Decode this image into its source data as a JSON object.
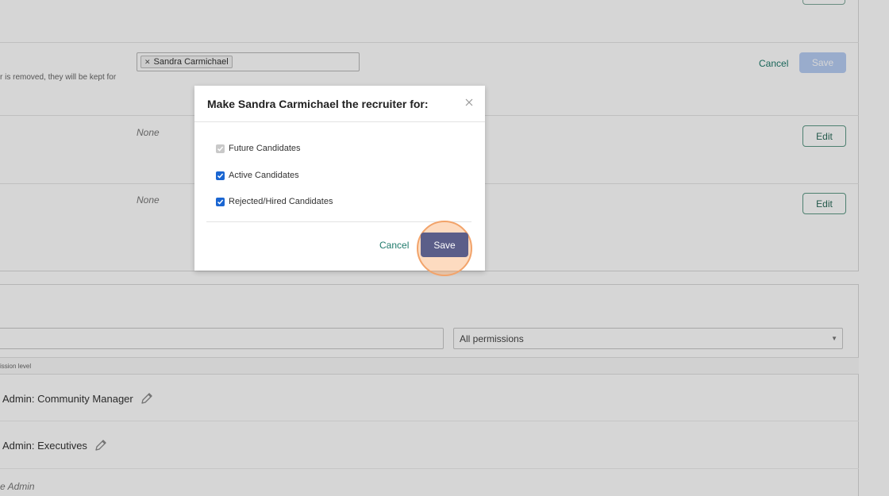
{
  "background": {
    "assignment": {
      "selected_tag": "Sandra Carmichael",
      "hint_text": "r is removed, they will be kept for",
      "cancel_label": "Cancel",
      "save_label": "Save"
    },
    "rows": [
      {
        "value": "None",
        "edit_label": "Edit"
      },
      {
        "value": "None",
        "edit_label": "Edit"
      }
    ],
    "permissions": {
      "filter_select_value": "All permissions",
      "column_header": "ission level",
      "items": [
        {
          "label": "Admin: Community Manager"
        },
        {
          "label": "Admin: Executives"
        }
      ],
      "partial_item": "e Admin"
    }
  },
  "modal": {
    "title": "Make Sandra Carmichael the recruiter for:",
    "options": [
      {
        "label": "Future Candidates",
        "checked": true,
        "disabled": true
      },
      {
        "label": "Active Candidates",
        "checked": true,
        "disabled": false
      },
      {
        "label": "Rejected/Hired Candidates",
        "checked": true,
        "disabled": false
      }
    ],
    "cancel_label": "Cancel",
    "save_label": "Save"
  },
  "colors": {
    "accent_link": "#1f7a6b",
    "save_primary": "#5b5e89",
    "checkbox": "#1a66d2",
    "highlight": "#f2a36a"
  }
}
